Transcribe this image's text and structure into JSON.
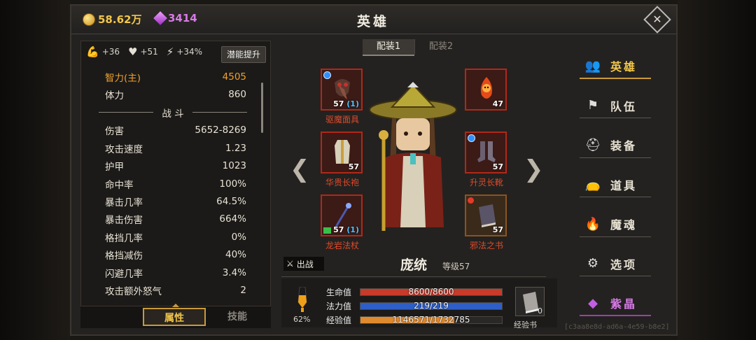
{
  "currency": {
    "gold": "58.62万",
    "gems": "3414"
  },
  "title": "英雄",
  "boosts": [
    {
      "icon": "strength-arm-icon",
      "value": "+36"
    },
    {
      "icon": "heart-icon",
      "value": "+51"
    },
    {
      "icon": "lightning-icon",
      "value": "+34%"
    }
  ],
  "potential_button": "潜能提升",
  "stats": {
    "primary": {
      "label": "智力(主)",
      "value": "4505"
    },
    "stamina": {
      "label": "体力",
      "value": "860"
    },
    "section": "战 斗",
    "combat": [
      {
        "label": "伤害",
        "value": "5652-8269"
      },
      {
        "label": "攻击速度",
        "value": "1.23"
      },
      {
        "label": "护甲",
        "value": "1023"
      },
      {
        "label": "命中率",
        "value": "100%"
      },
      {
        "label": "暴击几率",
        "value": "64.5%"
      },
      {
        "label": "暴击伤害",
        "value": "664%"
      },
      {
        "label": "格挡几率",
        "value": "0%"
      },
      {
        "label": "格挡减伤",
        "value": "40%"
      },
      {
        "label": "闪避几率",
        "value": "3.4%"
      },
      {
        "label": "攻击额外怒气",
        "value": "2"
      }
    ]
  },
  "tabs": {
    "attributes": "属性",
    "skills": "技能"
  },
  "loadouts": [
    "配装1",
    "配装2"
  ],
  "equipment": {
    "mask": {
      "name": "驱魔面具",
      "level": "57",
      "plus": "(1)"
    },
    "pet": {
      "name": "",
      "level": "47",
      "stars": "★★★★"
    },
    "robe": {
      "name": "华贵长袍",
      "level": "57"
    },
    "boots": {
      "name": "升灵长靴",
      "level": "57"
    },
    "staff": {
      "name": "龙岩法杖",
      "level": "57",
      "plus": "(1)"
    },
    "book": {
      "name": "邪法之书",
      "level": "57"
    }
  },
  "nav_arrows": {
    "left": "❮",
    "right": "❯"
  },
  "sortie_label": "出战",
  "hero": {
    "name": "庞统",
    "level": "等级57"
  },
  "potion_pct": "62%",
  "bars": {
    "hp": {
      "label": "生命值",
      "text": "8600/8600",
      "fraction": 1.0,
      "color": "#c83a2a"
    },
    "mp": {
      "label": "法力值",
      "text": "219/219",
      "fraction": 1.0,
      "color": "#2e5fc8"
    },
    "exp": {
      "label": "经验值",
      "text": "1146571/1732785",
      "fraction": 0.6617,
      "color": "#e08a30"
    }
  },
  "exp_book": {
    "count": "0",
    "label": "经验书"
  },
  "menu": [
    {
      "label": "英雄",
      "icon": "people-icon"
    },
    {
      "label": "队伍",
      "icon": "flag-icon"
    },
    {
      "label": "装备",
      "icon": "helmet-icon"
    },
    {
      "label": "道具",
      "icon": "bag-icon"
    },
    {
      "label": "魔魂",
      "icon": "flame-icon"
    },
    {
      "label": "选项",
      "icon": "gear-icon"
    },
    {
      "label": "紫晶",
      "icon": "purple-gem-icon"
    }
  ],
  "uid": "[c3aa8e8d-ad6a-4e59-b8e2]"
}
